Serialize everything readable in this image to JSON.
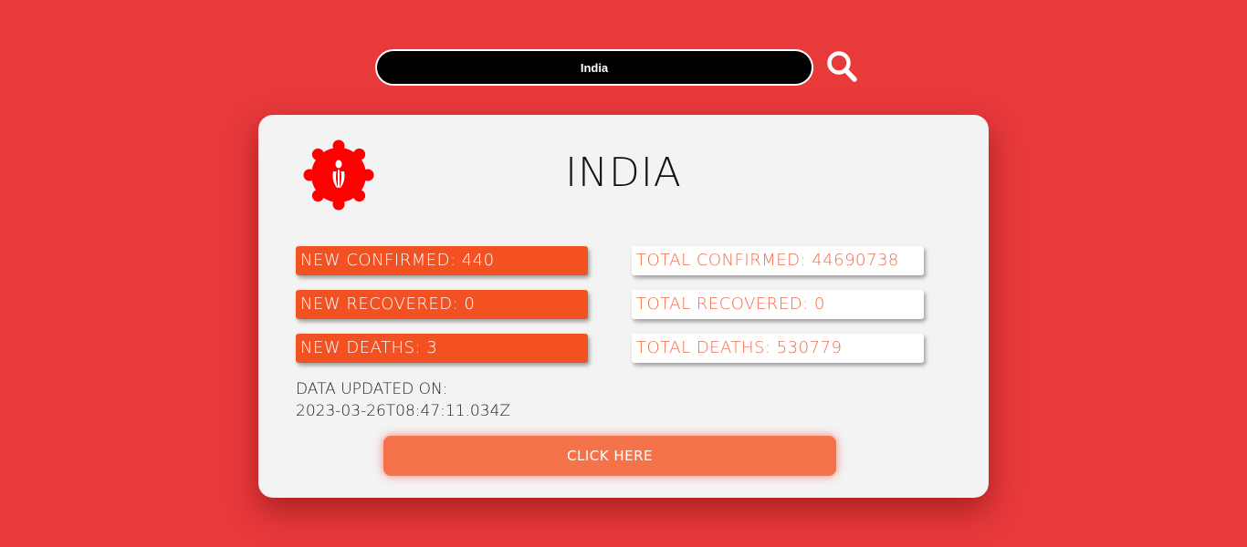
{
  "search": {
    "value": "India",
    "icon": "search-icon"
  },
  "card": {
    "logo_icon": "virus-icon",
    "country": "INDIA",
    "stats": {
      "new_confirmed": "NEW CONFIRMED: 440",
      "new_recovered": "NEW RECOVERED: 0",
      "new_deaths": "NEW DEATHS: 3",
      "total_confirmed": "TOTAL CONFIRMED: 44690738",
      "total_recovered": "TOTAL RECOVERED: 0",
      "total_deaths": "TOTAL DEATHS: 530779"
    },
    "updated_label": "DATA UPDATED ON:",
    "updated_value": "2023-03-26T08:47:11.034Z",
    "button_label": "CLICK HERE"
  },
  "colors": {
    "background": "#e8393b",
    "card": "#f3f3f3",
    "new_stat": "#f45122",
    "total_stat_text": "#f26b4a",
    "button": "#f5734a",
    "virus": "#ff0000"
  }
}
